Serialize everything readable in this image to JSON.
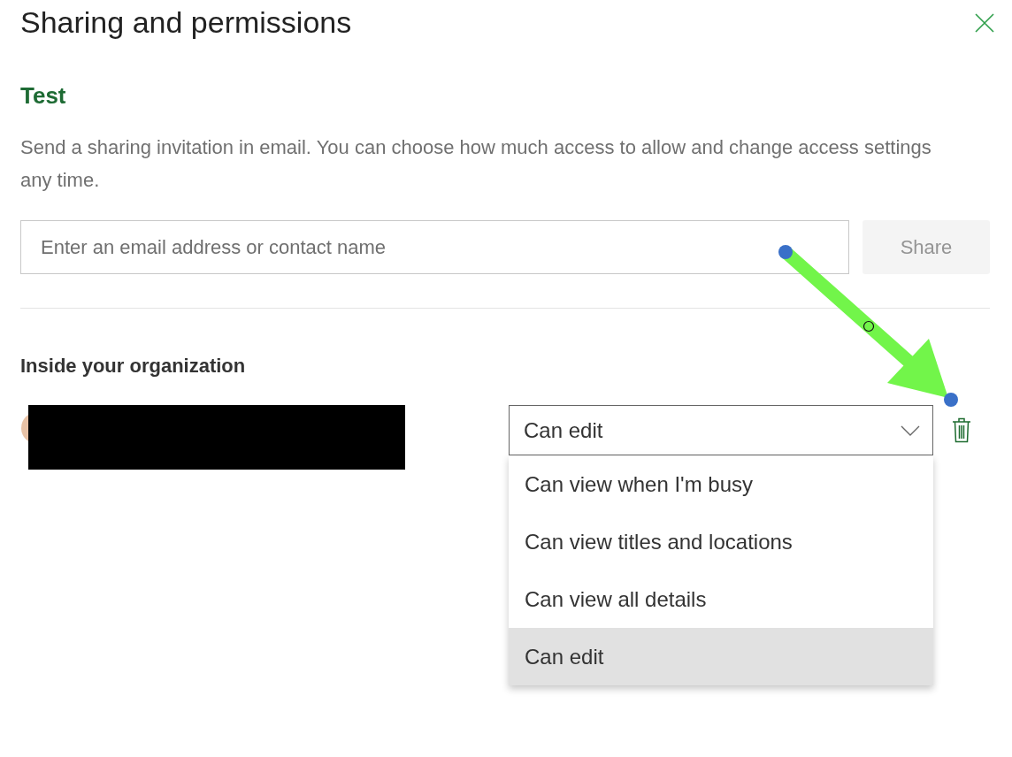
{
  "dialog": {
    "title": "Sharing and permissions"
  },
  "item_title": "Test",
  "description": "Send a sharing invitation in email. You can choose how much access to allow and change access settings any time.",
  "email_field": {
    "placeholder": "Enter an email address or contact name"
  },
  "share_button": {
    "label": "Share",
    "disabled": true
  },
  "section_heading": "Inside your organization",
  "member": {
    "permission": "Can edit"
  },
  "permission_menu": {
    "expanded": true,
    "options": [
      {
        "label": "Can view when I'm busy",
        "selected": false
      },
      {
        "label": "Can view titles and locations",
        "selected": false
      },
      {
        "label": "Can view all details",
        "selected": false
      },
      {
        "label": "Can edit",
        "selected": true
      }
    ]
  }
}
